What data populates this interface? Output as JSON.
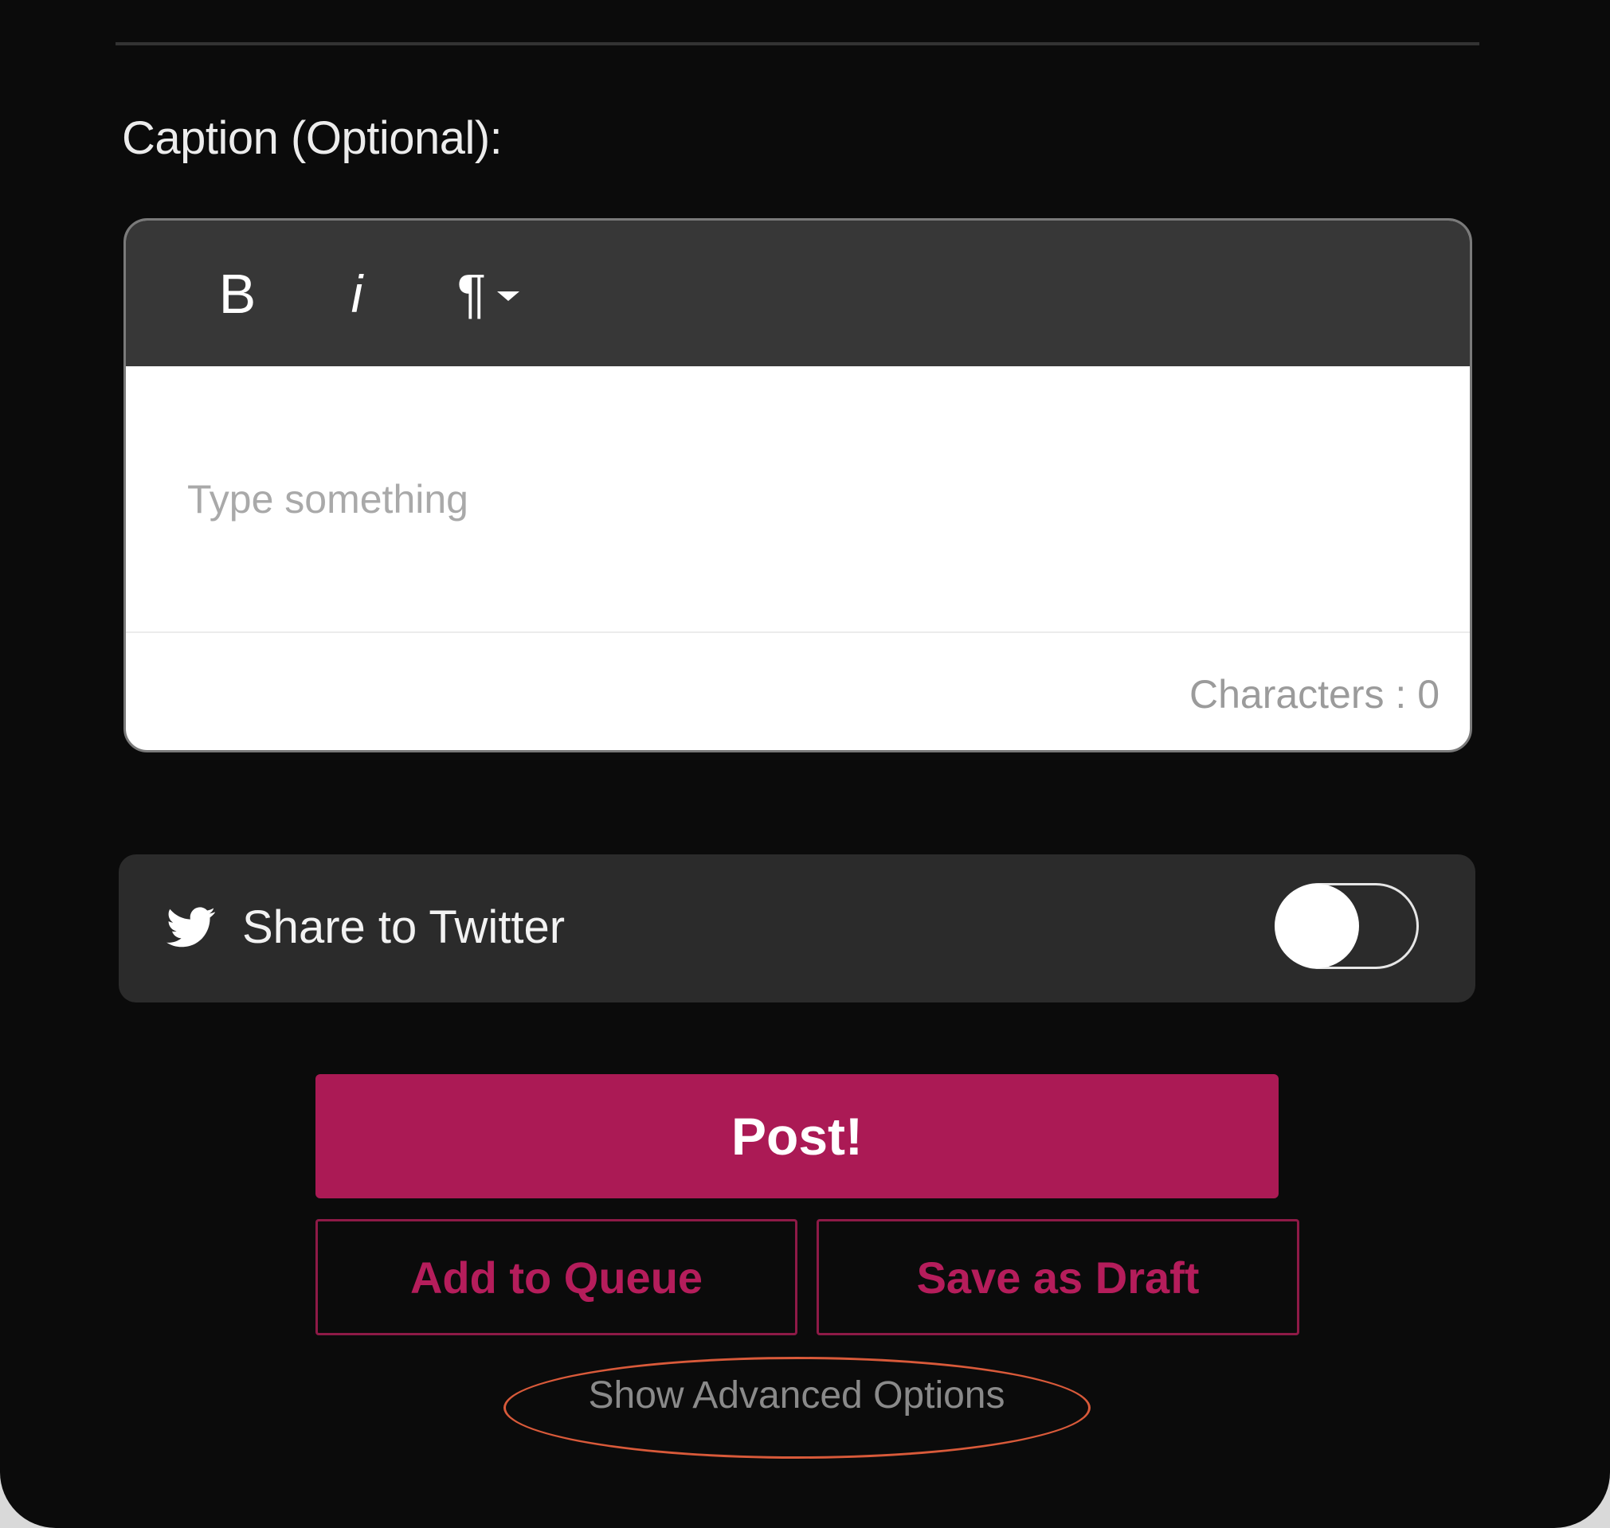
{
  "caption": {
    "label": "Caption (Optional):"
  },
  "editor": {
    "toolbar": {
      "bold_label": "B",
      "italic_label": "i",
      "paragraph_label": "¶"
    },
    "placeholder": "Type something",
    "char_count": "Characters : 0"
  },
  "share": {
    "label": "Share to Twitter",
    "icon": "twitter-bird-icon",
    "enabled": false
  },
  "actions": {
    "post_label": "Post!",
    "queue_label": "Add to Queue",
    "draft_label": "Save as Draft",
    "advanced_label": "Show Advanced Options"
  },
  "colors": {
    "background": "#0b0b0b",
    "accent": "#ab1a55",
    "toolbar": "#373737",
    "share_row": "#2b2b2b",
    "annotation": "#d95a3a"
  }
}
